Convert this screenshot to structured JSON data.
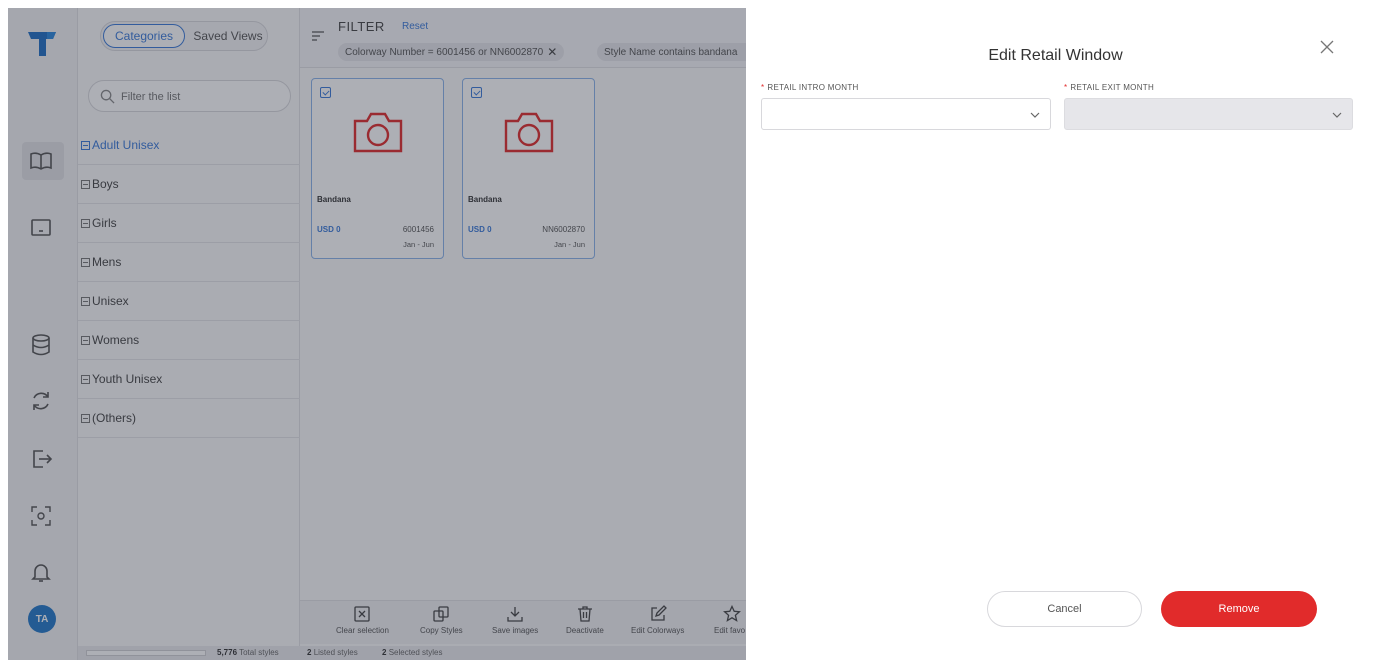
{
  "rail": {
    "logo_icon": "t-logo-icon",
    "items": [
      "book-icon",
      "monitor-icon",
      "database-icon",
      "sync-icon",
      "export-icon",
      "scan-icon",
      "bell-icon"
    ],
    "avatar_initials": "TA",
    "accent": "#2378c8"
  },
  "sidebar": {
    "tabs": [
      {
        "label": "Categories",
        "selected": true
      },
      {
        "label": "Saved Views",
        "selected": false
      }
    ],
    "filter_placeholder": "Filter the list",
    "categories": [
      "Adult Unisex",
      "Boys",
      "Girls",
      "Mens",
      "Unisex",
      "Womens",
      "Youth Unisex",
      "(Others)"
    ]
  },
  "filter_bar": {
    "title": "FILTER",
    "reset_label": "Reset",
    "chips": [
      {
        "text": "Colorway Number = 6001456 or NN6002870",
        "close": "✕"
      },
      {
        "text": "Style Name contains bandana"
      }
    ]
  },
  "cards": [
    {
      "name": "Bandana",
      "price": "USD 0",
      "number": "6001456",
      "window": "Jan - Jun"
    },
    {
      "name": "Bandana",
      "price": "USD 0",
      "number": "NN6002870",
      "window": "Jan - Jun"
    }
  ],
  "toolbar": {
    "items": [
      {
        "label": "Clear selection",
        "icon": "clear-selection-icon"
      },
      {
        "label": "Copy Styles",
        "icon": "copy-icon"
      },
      {
        "label": "Save images",
        "icon": "download-icon"
      },
      {
        "label": "Deactivate",
        "icon": "trash-icon"
      },
      {
        "label": "Edit Colorways",
        "icon": "edit-icon"
      },
      {
        "label": "Edit favo",
        "icon": "star-icon"
      }
    ]
  },
  "status": {
    "total_count": "5,776",
    "total_label": "Total styles",
    "listed_count": "2",
    "listed_label": "Listed styles",
    "selected_count": "2",
    "selected_label": "Selected styles"
  },
  "modal": {
    "title": "Edit Retail Window",
    "intro_label": "RETAIL INTRO MONTH",
    "exit_label": "RETAIL EXIT MONTH",
    "intro_value": "",
    "exit_value": "",
    "required_mark": "*",
    "cancel_label": "Cancel",
    "remove_label": "Remove",
    "danger_color": "#e12b2b"
  }
}
